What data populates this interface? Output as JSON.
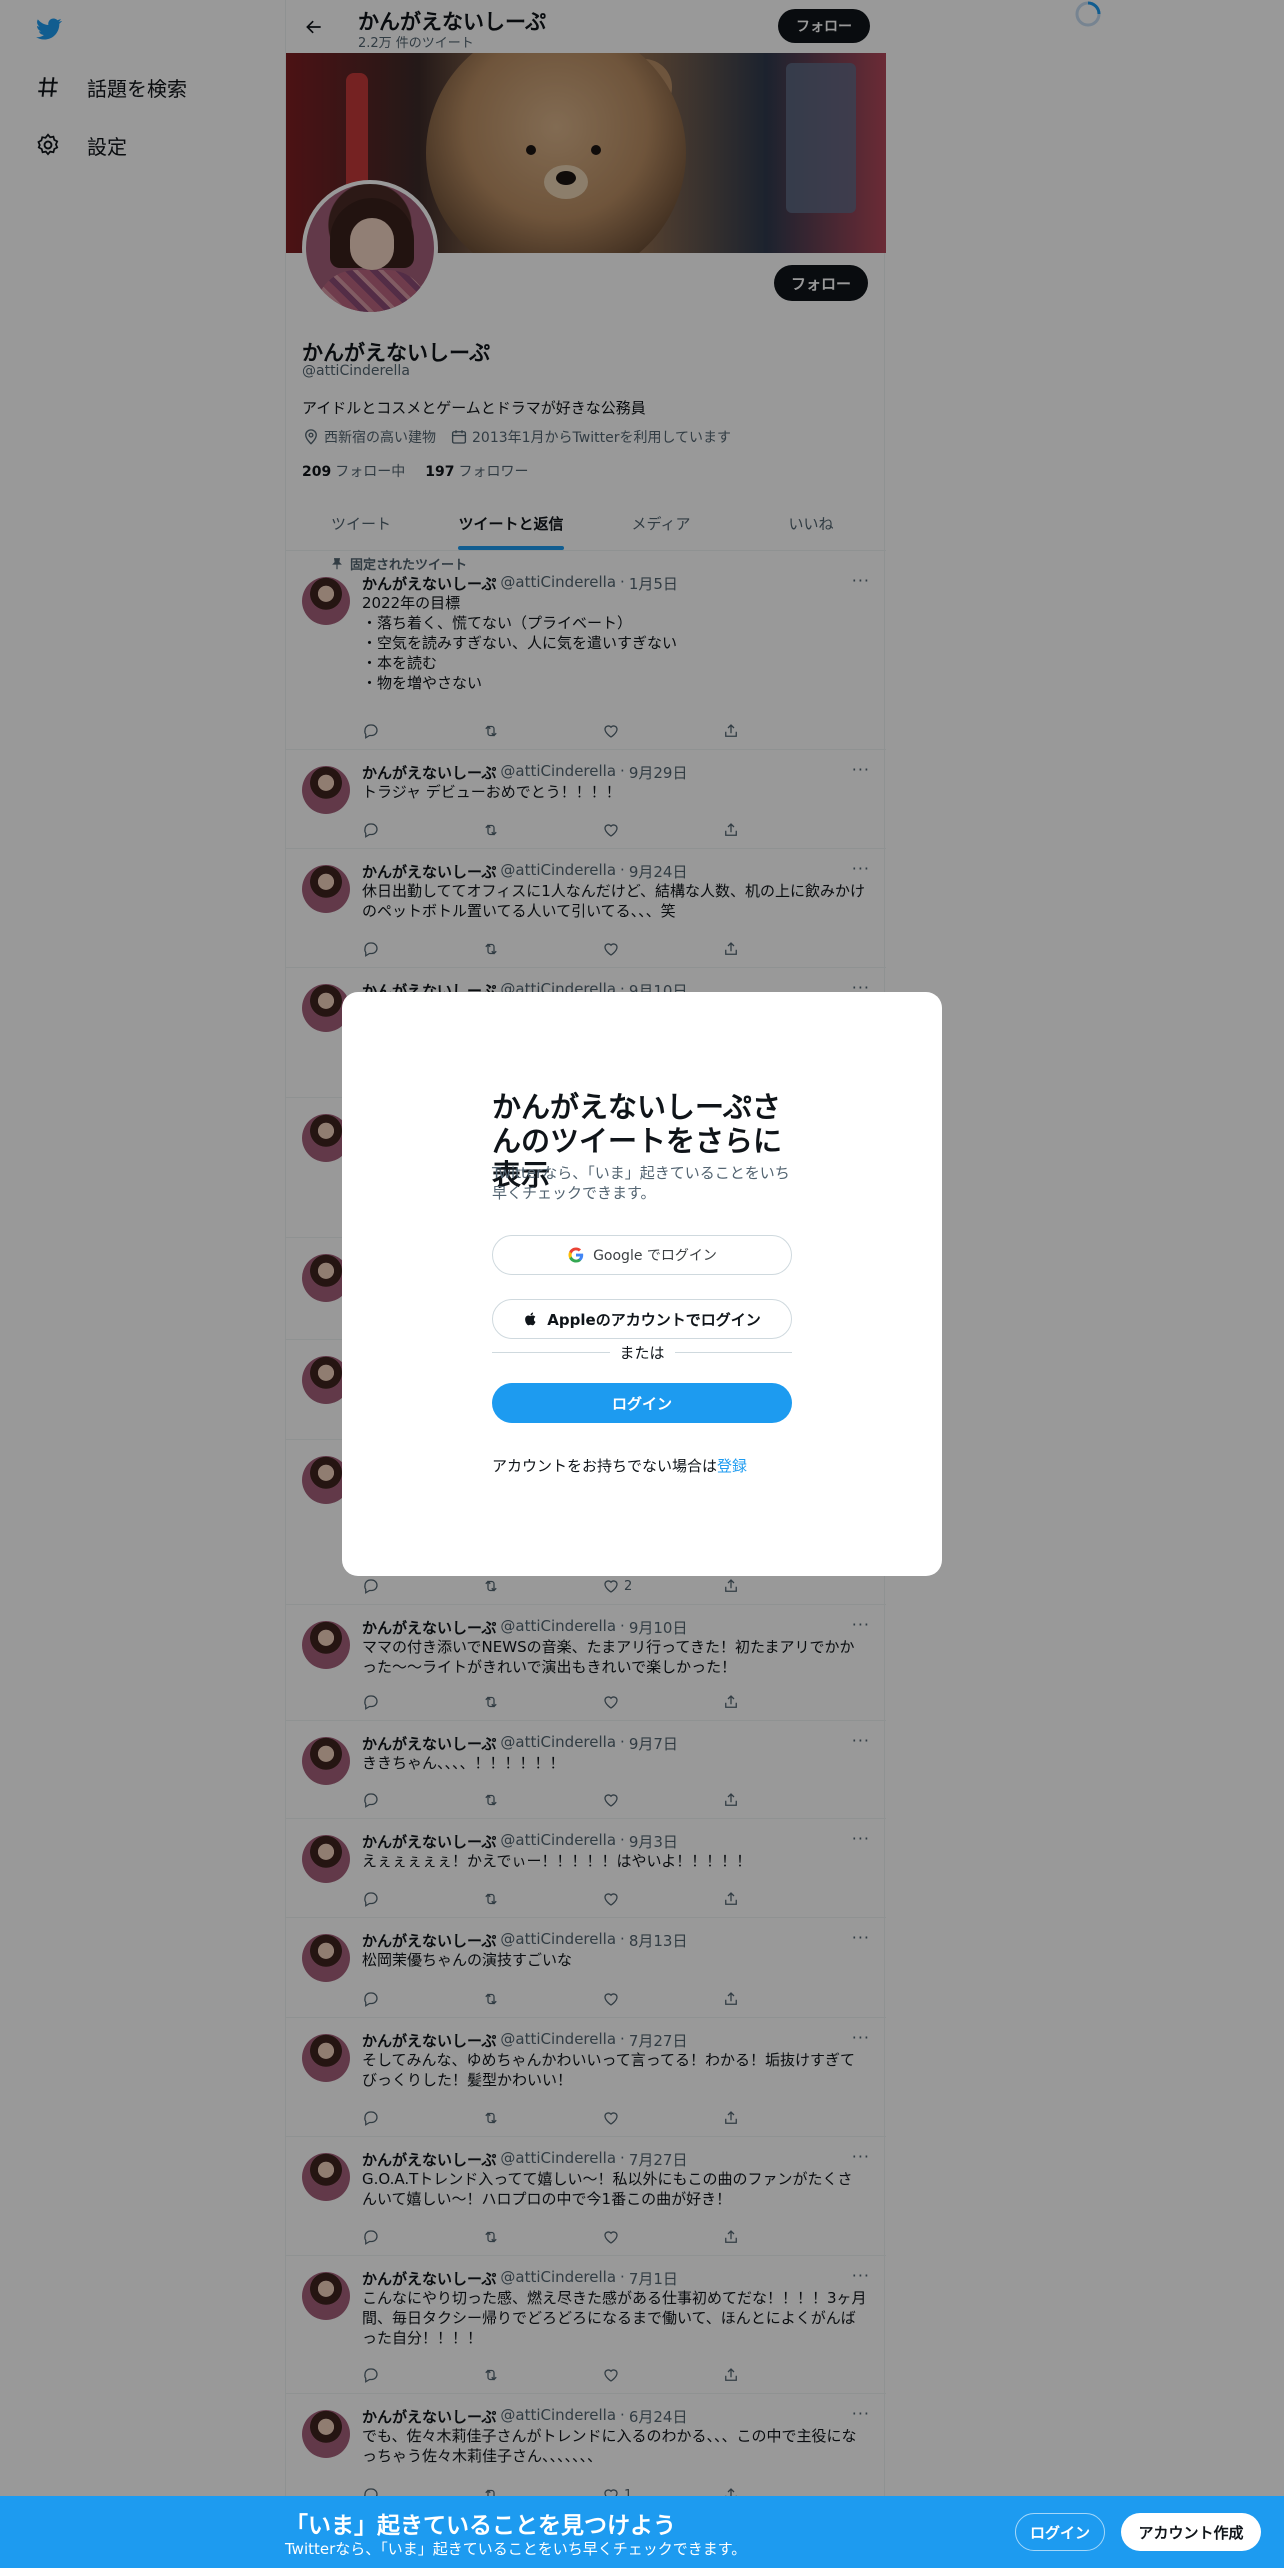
{
  "nav": {
    "items": [
      {
        "label": "話題を検索",
        "icon": "hashtag-icon"
      },
      {
        "label": "設定",
        "icon": "gear-icon"
      }
    ]
  },
  "header": {
    "name": "かんがえないしーぷ",
    "tweet_count": "2.2万 件のツイート",
    "follow_label": "フォロー"
  },
  "profile": {
    "name": "かんがえないしーぷ",
    "handle": "@attiCinderella",
    "bio": "アイドルとコスメとゲームとドラマが好きな公務員",
    "location": "西新宿の高い建物",
    "joined": "2013年1月からTwitterを利用しています",
    "following_count": "209",
    "following_label": "フォロー中",
    "followers_count": "197",
    "followers_label": "フォロワー",
    "follow_label": "フォロー"
  },
  "tabs": [
    "ツイート",
    "ツイートと返信",
    "メディア",
    "いいね"
  ],
  "pinned_label": "固定されたツイート",
  "tweets": [
    {
      "name": "かんがえないしーぷ",
      "handle": "@attiCinderella",
      "date": "1月5日",
      "text": "2022年の目標\n・落ち着く、慌てない（プライベート）\n・空気を読みすぎない、人に気を遣いすぎない\n・本を読む\n・物を増やさない"
    },
    {
      "name": "かんがえないしーぷ",
      "handle": "@attiCinderella",
      "date": "9月29日",
      "text": "トラジャ デビューおめでとう！！！！"
    },
    {
      "name": "かんがえないしーぷ",
      "handle": "@attiCinderella",
      "date": "9月24日",
      "text": "休日出勤しててオフィスに1人なんだけど、結構な人数、机の上に飲みかけのペットボトル置いてる人いて引いてる、、、笑"
    },
    {
      "name": "かんがえないしーぷ",
      "handle": "@attiCinderella",
      "date": "9月10日",
      "text": ""
    },
    {
      "name": "かんがえないしーぷ",
      "handle": "@attiCinderella",
      "date": "9月10日",
      "text": "ママの付き添いでNEWSの音楽、たまアリ行ってきた！初たまアリでかかった〜〜ライトがきれいで演出もきれいで楽しかった！"
    },
    {
      "name": "かんがえないしーぷ",
      "handle": "@attiCinderella",
      "date": "9月7日",
      "text": "ききちゃん、、、、！！！！！！"
    },
    {
      "name": "かんがえないしーぷ",
      "handle": "@attiCinderella",
      "date": "9月3日",
      "text": "えぇぇぇぇぇ！かえでぃー！！！！！はやいよ！！！！！"
    },
    {
      "name": "かんがえないしーぷ",
      "handle": "@attiCinderella",
      "date": "8月13日",
      "text": "松岡茉優ちゃんの演技すごいな"
    },
    {
      "name": "かんがえないしーぷ",
      "handle": "@attiCinderella",
      "date": "7月27日",
      "text": "そしてみんな、ゆめちゃんかわいいって言ってる！わかる！垢抜けすぎてびっくりした！髪型かわいい！"
    },
    {
      "name": "かんがえないしーぷ",
      "handle": "@attiCinderella",
      "date": "7月27日",
      "text": "G.O.A.Tトレンド入ってて嬉しい〜！私以外にもこの曲のファンがたくさんいて嬉しい〜！ハロプロの中で今1番この曲が好き！"
    },
    {
      "name": "かんがえないしーぷ",
      "handle": "@attiCinderella",
      "date": "7月1日",
      "text": "こんなにやり切った感、燃え尽きた感がある仕事初めてだな！！！！3ヶ月間、毎日タクシー帰りでどろどろになるまで働いて、ほんとによくがんばった自分！！！！"
    },
    {
      "name": "かんがえないしーぷ",
      "handle": "@attiCinderella",
      "date": "6月24日",
      "text": "でも、佐々木莉佳子さんがトレンドに入るのわかる、、、この中で主役になっちゃう佐々木莉佳子さん、、、、、、、"
    }
  ],
  "tweet_extras": {
    "hidden_like_count": "2",
    "last_like_count": "1"
  },
  "modal": {
    "title": "かんがえないしーぷさんのツイートをさらに表示",
    "subtitle": "Twitterなら、「いま」起きていることをいち早くチェックできます。",
    "google_label": "Google でログイン",
    "apple_label": "Appleのアカウントでログイン",
    "or_label": "または",
    "login_label": "ログイン",
    "signup_prompt": "アカウントをお持ちでない場合は",
    "signup_link": "登録"
  },
  "bottombar": {
    "title": "「いま」起きていることを見つけよう",
    "subtitle": "Twitterなら、「いま」起きていることをいち早くチェックできます。",
    "login_label": "ログイン",
    "signup_label": "アカウント作成"
  },
  "colors": {
    "accent": "#1d9bf0",
    "text": "#0f1419",
    "muted": "#536471",
    "overlay": "rgba(0,0,0,0.4)"
  }
}
